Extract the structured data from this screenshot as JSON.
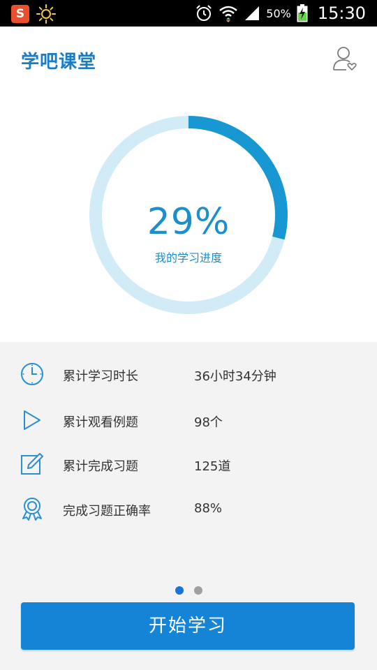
{
  "status_bar": {
    "battery_percent": "50%",
    "time": "15:30",
    "icons": [
      "app-s-icon",
      "sun-icon",
      "alarm-icon",
      "wifi-icon",
      "signal-icon",
      "battery-charging-icon"
    ]
  },
  "header": {
    "title": "学吧课堂",
    "profile_icon": "user-heart-icon"
  },
  "progress": {
    "value_text": "29%",
    "fraction": 0.29,
    "caption": "我的学习进度",
    "colors": {
      "track": "#d2ecf7",
      "fill": "#1898d2"
    }
  },
  "stats": [
    {
      "icon": "clock-icon",
      "label": "累计学习时长",
      "value": "36小时34分钟"
    },
    {
      "icon": "play-icon",
      "label": "累计观看例题",
      "value": "98个"
    },
    {
      "icon": "edit-icon",
      "label": "累计完成习题",
      "value": "125道"
    },
    {
      "icon": "award-icon",
      "label": "完成习题正确率",
      "value": "88%"
    }
  ],
  "pager": {
    "count": 2,
    "active": 1
  },
  "start_button": {
    "label": "开始学习"
  },
  "colors": {
    "accent": "#1583d6",
    "title": "#1b7cc6",
    "background": "#f3f3f3"
  }
}
